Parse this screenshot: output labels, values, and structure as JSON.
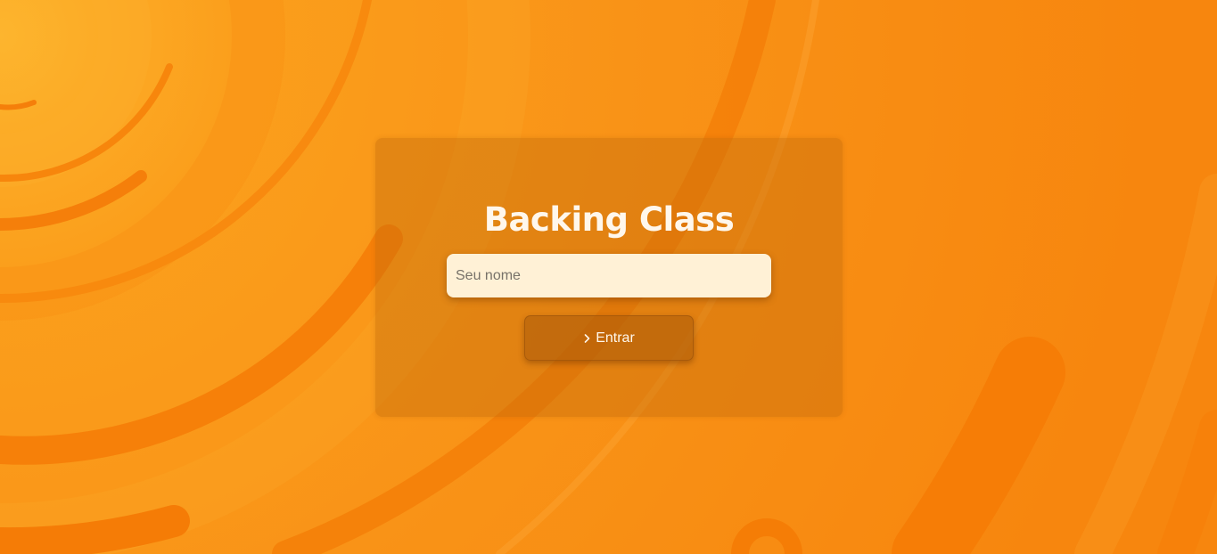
{
  "app": {
    "title": "Backing Class"
  },
  "login": {
    "name_placeholder": "Seu nome",
    "name_value": "",
    "enter_label": "Entrar",
    "enter_icon": "chevron-right-icon"
  },
  "theme": {
    "background": "#f99317",
    "accent_dark": "#f57a06",
    "input_background": "#fff1d6",
    "text_light": "#fff7ec"
  }
}
